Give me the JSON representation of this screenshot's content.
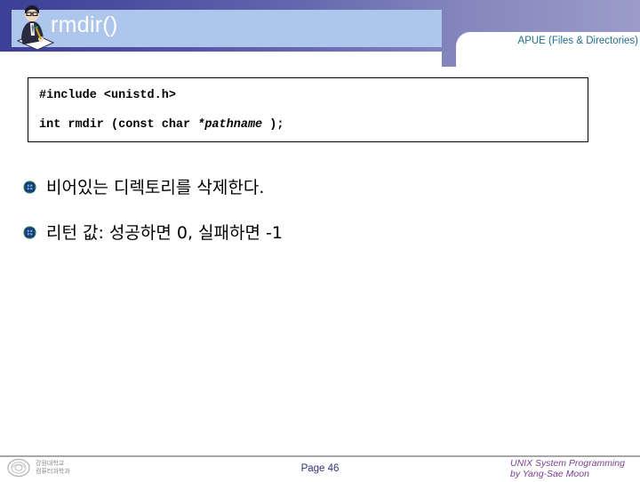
{
  "slide": {
    "header": {
      "title": "rmdir()",
      "icon": "person-writing-icon",
      "course_label": "APUE (Files & Directories)",
      "gradient_left": "#3d3f96",
      "gradient_right": "#a0a1cb",
      "title_bar_color": "#aec6ec",
      "course_label_color": "#1f6d8c"
    },
    "code_box": {
      "line1": "#include <unistd.h>",
      "line2_prefix": "int rmdir (const char ",
      "line2_italic": "*pathname",
      "line2_suffix": " );",
      "border_color": "#000000"
    },
    "bullets": [
      {
        "marker": "decorative-bullet-icon",
        "text": "비어있는 디렉토리를 삭제한다."
      },
      {
        "marker": "decorative-bullet-icon",
        "text": "리턴 값: 성공하면 0, 실패하면 -1"
      }
    ],
    "footer": {
      "logo": "university-seal-icon",
      "logo_text": "강원대학교\n컴퓨터과학과",
      "page_label": "Page 46",
      "page_color": "#333377",
      "credit_line1": "UNIX System Programming",
      "credit_line2": "by Yang-Sae Moon",
      "credit_color": "#7a3f8f"
    }
  }
}
